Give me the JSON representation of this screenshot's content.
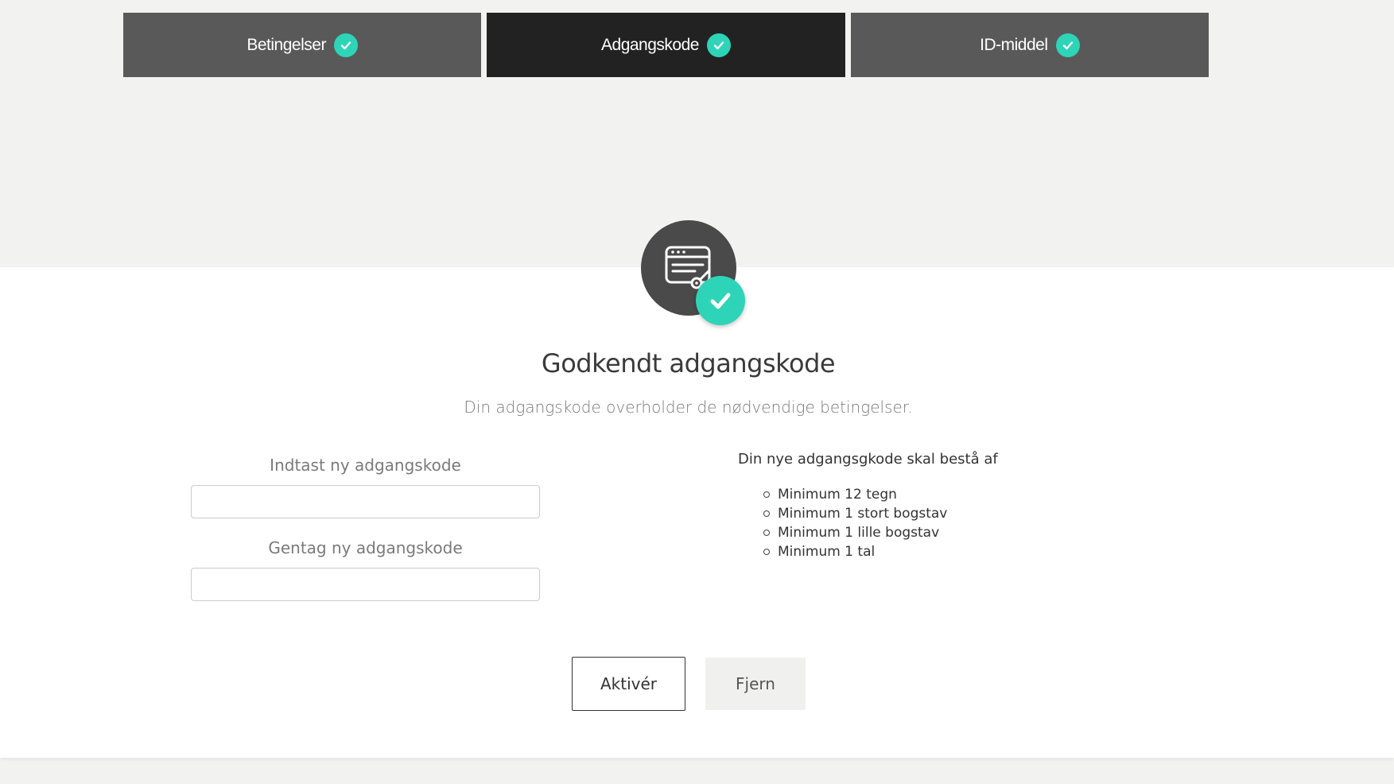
{
  "steps": [
    {
      "label": "Betingelser",
      "completed": true,
      "active": false
    },
    {
      "label": "Adgangskode",
      "completed": true,
      "active": true
    },
    {
      "label": "ID-middel",
      "completed": true,
      "active": false
    }
  ],
  "status": {
    "title": "Godkendt adgangskode",
    "subtitle": "Din adgangskode overholder de nødvendige betingelser."
  },
  "form": {
    "new_password_label": "Indtast ny adgangskode",
    "new_password_value": "",
    "repeat_password_label": "Gentag ny adgangskode",
    "repeat_password_value": ""
  },
  "requirements": {
    "title": "Din nye adgangsgkode skal bestå af",
    "items": [
      "Minimum 12 tegn",
      "Minimum 1 stort bogstav",
      "Minimum 1 lille bogstav",
      "Minimum 1 tal"
    ]
  },
  "actions": {
    "activate_label": "Aktivér",
    "remove_label": "Fjern"
  },
  "colors": {
    "accent": "#2dd4b8",
    "step_bg": "#595959",
    "step_active_bg": "#222222",
    "page_bg": "#f2f2f1"
  },
  "icons": {
    "step_check": "checkmark-icon",
    "hero": "password-browser-icon",
    "hero_check": "checkmark-icon"
  }
}
